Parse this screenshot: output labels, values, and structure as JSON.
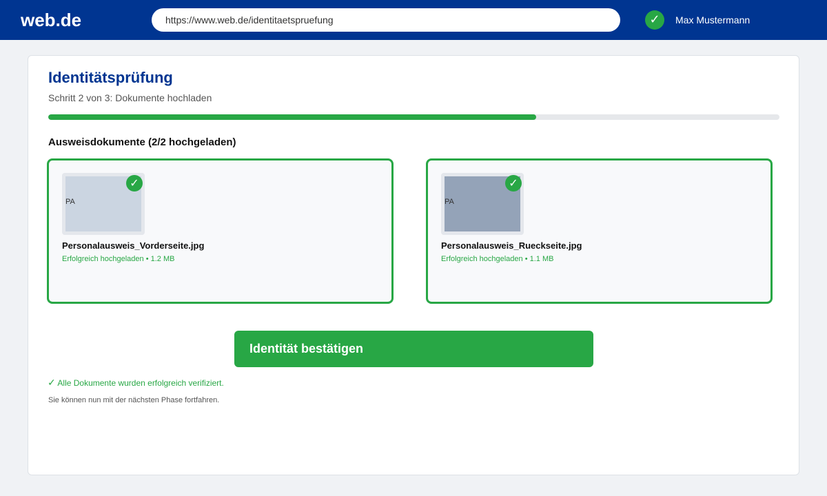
{
  "header": {
    "logo": "web.de",
    "url": "https://www.web.de/identitaetspruefung",
    "user_name": "Max Mustermann",
    "user_check": "✓"
  },
  "main": {
    "title": "Identitätsprüfung",
    "step": "Schritt 2 von 3: Dokumente hochladen",
    "progress_fraction": 0.667,
    "section_title": "Ausweisdokumente (2/2 hochgeladen)",
    "documents": [
      {
        "thumb_label": "PA",
        "check": "✓",
        "file_name": "Personalausweis_Vorderseite.jpg",
        "status": "Erfolgreich hochgeladen • 1.2 MB",
        "thumb_color": "#cbd5e1"
      },
      {
        "thumb_label": "PA",
        "check": "✓",
        "file_name": "Personalausweis_Rueckseite.jpg",
        "status": "Erfolgreich hochgeladen • 1.1 MB",
        "thumb_color": "#94a3b8"
      }
    ],
    "confirm_button": "Identität bestätigen",
    "verified_check": "✓",
    "verified_message": "Alle Dokumente wurden erfolgreich verifiziert.",
    "next_message": "Sie können nun mit der nächsten Phase fortfahren."
  },
  "colors": {
    "brand": "#003591",
    "success": "#28a745"
  }
}
